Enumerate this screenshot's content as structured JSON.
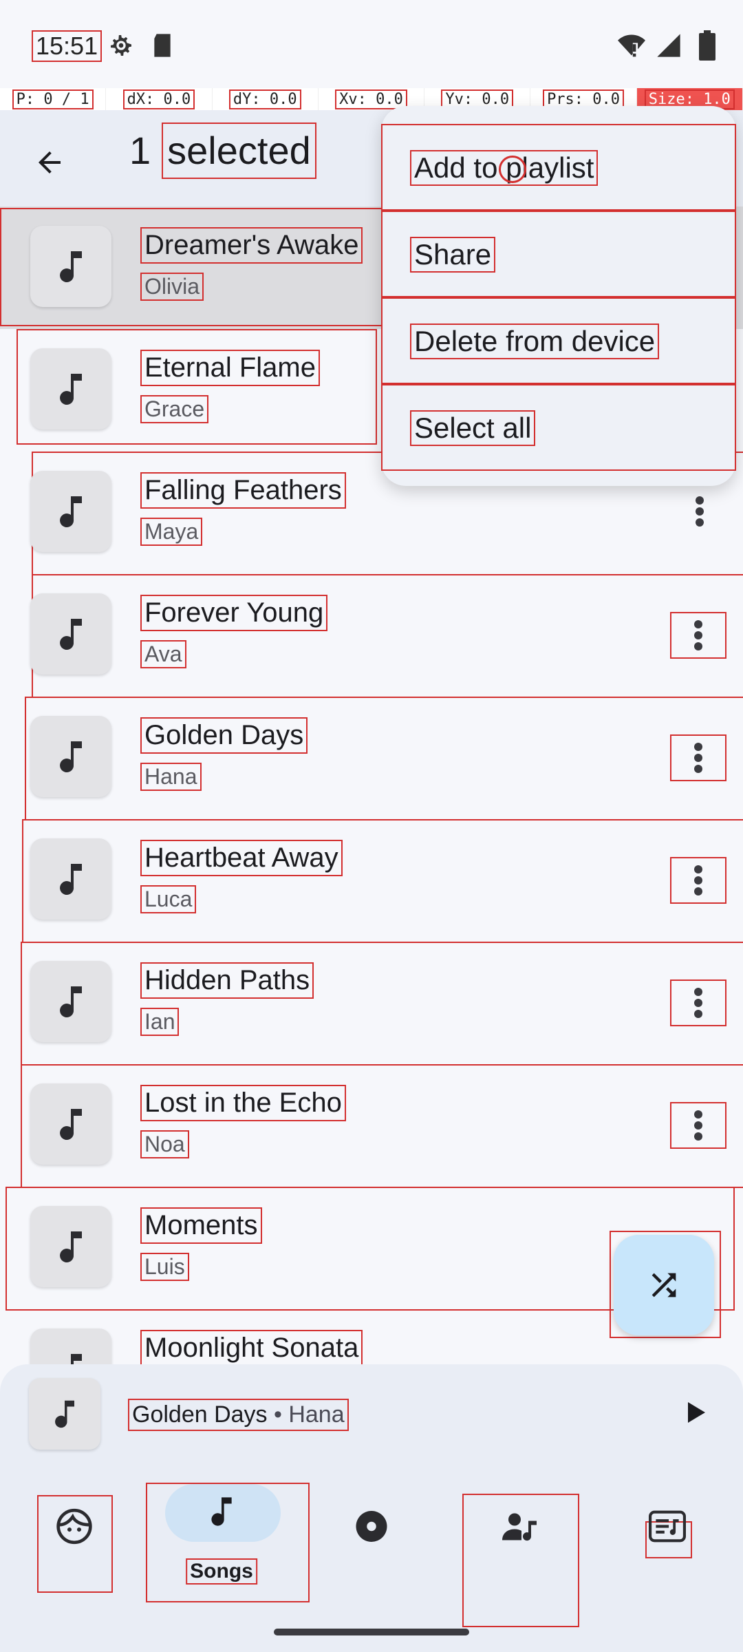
{
  "status_bar": {
    "time": "15:51",
    "icons": [
      "settings-icon",
      "sd-card-icon",
      "wifi-alert-icon",
      "signal-icon",
      "battery-icon"
    ]
  },
  "pointer_bar": {
    "p": "P: 0 / 1",
    "dx": "dX: 0.0",
    "dy": "dY: 0.0",
    "xv": "Xv: 0.0",
    "yv": "Yv: 0.0",
    "prs": "Prs: 0.0",
    "size": "Size: 1.0"
  },
  "app_bar": {
    "count": "1",
    "selected_label": "selected"
  },
  "menu": {
    "items": [
      {
        "label": "Add to playlist"
      },
      {
        "label": "Share"
      },
      {
        "label": "Delete from device"
      },
      {
        "label": "Select all"
      }
    ]
  },
  "songs": [
    {
      "title": "Dreamer's Awake",
      "artist": "Olivia",
      "selected": true
    },
    {
      "title": "Eternal Flame",
      "artist": "Grace"
    },
    {
      "title": "Falling Feathers",
      "artist": "Maya"
    },
    {
      "title": "Forever Young",
      "artist": "Ava"
    },
    {
      "title": "Golden Days",
      "artist": "Hana"
    },
    {
      "title": "Heartbeat Away",
      "artist": "Luca"
    },
    {
      "title": "Hidden Paths",
      "artist": "Ian"
    },
    {
      "title": "Lost in the Echo",
      "artist": "Noa"
    },
    {
      "title": "Moments",
      "artist": "Luis"
    },
    {
      "title": "Moonlight Sonata",
      "artist": ""
    }
  ],
  "mini_player": {
    "title": "Golden Days",
    "separator": " • ",
    "artist": "Hana"
  },
  "bottom_nav": {
    "items": [
      {
        "icon": "face-icon",
        "label": ""
      },
      {
        "icon": "music-note-icon",
        "label": "Songs",
        "active": true
      },
      {
        "icon": "album-icon",
        "label": ""
      },
      {
        "icon": "artist-icon",
        "label": ""
      },
      {
        "icon": "playlist-icon",
        "label": ""
      }
    ]
  },
  "colors": {
    "accent": "#cfe3f5",
    "fab": "#c8e6fb",
    "debug_outline": "#d32f2f",
    "background": "#f6f7fb"
  }
}
